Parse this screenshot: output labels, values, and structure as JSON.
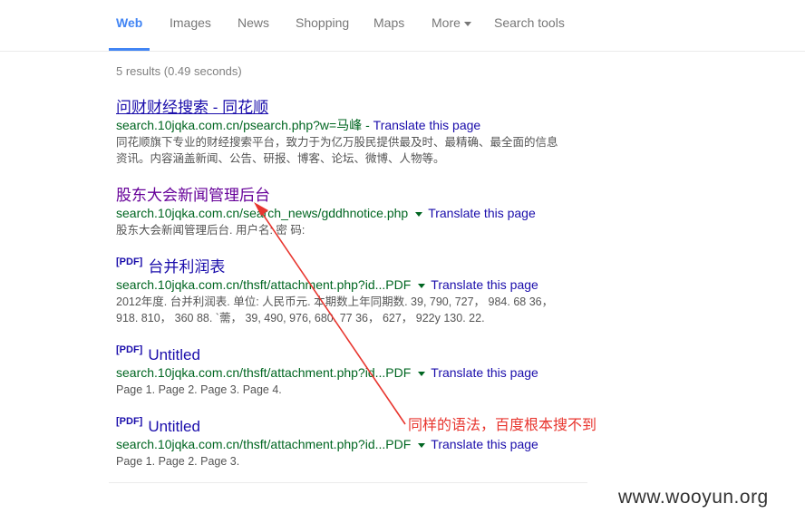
{
  "tabs": {
    "web": "Web",
    "images": "Images",
    "news": "News",
    "shopping": "Shopping",
    "maps": "Maps",
    "more": "More",
    "search_tools": "Search tools"
  },
  "stats": "5 results (0.49 seconds)",
  "results": [
    {
      "title": "问财财经搜索 - 同花顺",
      "url": "search.10jqka.com.cn/psearch.php?w=马峰",
      "translate": "Translate this page",
      "snippet1": "同花顺旗下专业的财经搜索平台，致力于为亿万股民提供最及时、最精确、最全面的信息",
      "snippet2": "资讯。内容涵盖新闻、公告、研报、博客、论坛、微博、人物等。"
    },
    {
      "title": "股东大会新闻管理后台",
      "url": "search.10jqka.com.cn/search_news/gddhnotice.php",
      "translate": "Translate this page",
      "snippet1": "股东大会新闻管理后台. 用户名: 密 码:"
    },
    {
      "pdf": "[PDF]",
      "title": "台并利润表",
      "url": "search.10jqka.com.cn/thsft/attachment.php?id...PDF",
      "translate": "Translate this page",
      "snippet1": "2012年度. 台并利润表. 单位: 人民币元. 本期数上年同期数. 39, 790, 727， 984. 68 36，",
      "snippet2": "918. 810， 360 88. `薷， 39, 490, 976, 680. 77 36， 627， 922y 130. 22."
    },
    {
      "pdf": "[PDF]",
      "title": "Untitled",
      "url": "search.10jqka.com.cn/thsft/attachment.php?id...PDF",
      "translate": "Translate this page",
      "snippet1": "Page 1. Page 2. Page 3. Page 4."
    },
    {
      "pdf": "[PDF]",
      "title": "Untitled",
      "url": "search.10jqka.com.cn/thsft/attachment.php?id...PDF",
      "translate": "Translate this page",
      "snippet1": "Page 1. Page 2. Page 3."
    }
  ],
  "annotation": "同样的语法，百度根本搜不到",
  "watermark": "www.wooyun.org",
  "colors": {
    "active_tab": "#4285f4",
    "link": "#1a0dab",
    "visited": "#660099",
    "url": "#006621",
    "annotation": "#e8362f"
  }
}
